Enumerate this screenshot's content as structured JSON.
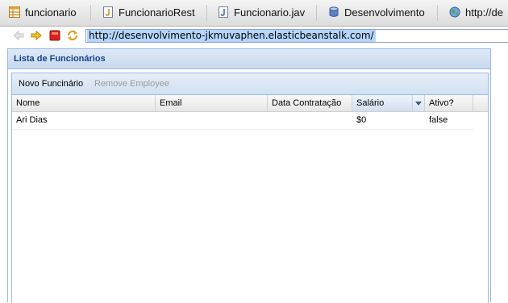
{
  "browser": {
    "tabs": [
      {
        "label": "funcionario",
        "icon": "table-icon"
      },
      {
        "label": "FuncionarioRest",
        "icon": "java-file-icon"
      },
      {
        "label": "Funcionario.jav",
        "icon": "java-file-icon"
      },
      {
        "label": "Desenvolvimento",
        "icon": "database-icon"
      },
      {
        "label": "http://de",
        "icon": "globe-icon"
      }
    ],
    "url": "http://desenvolvimento-jkmuvaphen.elasticbeanstalk.com/"
  },
  "panel": {
    "title": "Lista de Funcionários",
    "toolbar": {
      "add_label": "Novo Funcinário",
      "remove_label": "Remove Employee"
    },
    "grid": {
      "columns": [
        {
          "label": "Nome"
        },
        {
          "label": "Email"
        },
        {
          "label": "Data Contratação"
        },
        {
          "label": "Salário",
          "sorted": true
        },
        {
          "label": "Ativo?"
        }
      ],
      "rows": [
        {
          "nome": "Ari Dias",
          "email": "",
          "data": "",
          "salario": "$0",
          "ativo": "false"
        }
      ]
    }
  },
  "colors": {
    "panel_border": "#99bbe8",
    "panel_title": "#15428b",
    "url_selection": "#b5d5ff"
  }
}
